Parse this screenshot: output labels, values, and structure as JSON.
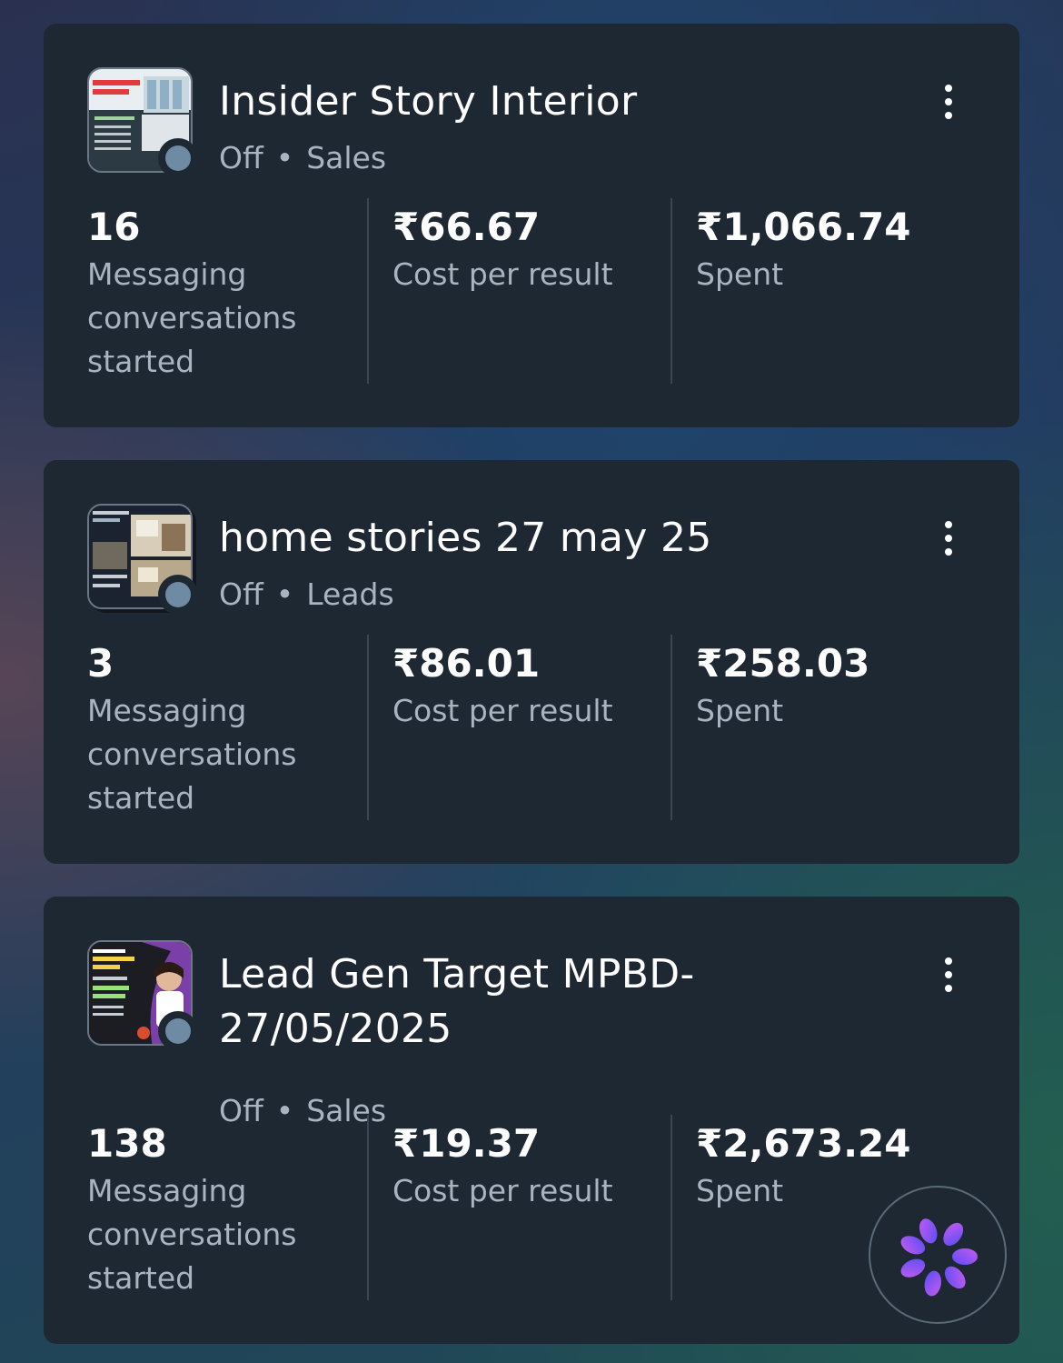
{
  "campaigns": [
    {
      "title": "Insider Story Interior",
      "status": "Off",
      "objective": "Sales",
      "separator": "•",
      "metrics": [
        {
          "value": "16",
          "label": "Messaging conversations started"
        },
        {
          "value": "₹66.67",
          "label": "Cost per result"
        },
        {
          "value": "₹1,066.74",
          "label": "Spent"
        }
      ]
    },
    {
      "title": "home stories 27 may 25",
      "status": "Off",
      "objective": "Leads",
      "separator": "•",
      "metrics": [
        {
          "value": "3",
          "label": "Messaging conversations started"
        },
        {
          "value": "₹86.01",
          "label": "Cost per result"
        },
        {
          "value": "₹258.03",
          "label": "Spent"
        }
      ]
    },
    {
      "title": "Lead Gen Target MPBD-27/05/2025",
      "status": "Off",
      "objective": "Sales",
      "separator": "•",
      "metrics": [
        {
          "value": "138",
          "label": "Messaging conversations started"
        },
        {
          "value": "₹19.37",
          "label": "Cost per result"
        },
        {
          "value": "₹2,673.24",
          "label": "Spent"
        }
      ]
    }
  ],
  "fab": {
    "icon": "ai-assistant-icon"
  }
}
